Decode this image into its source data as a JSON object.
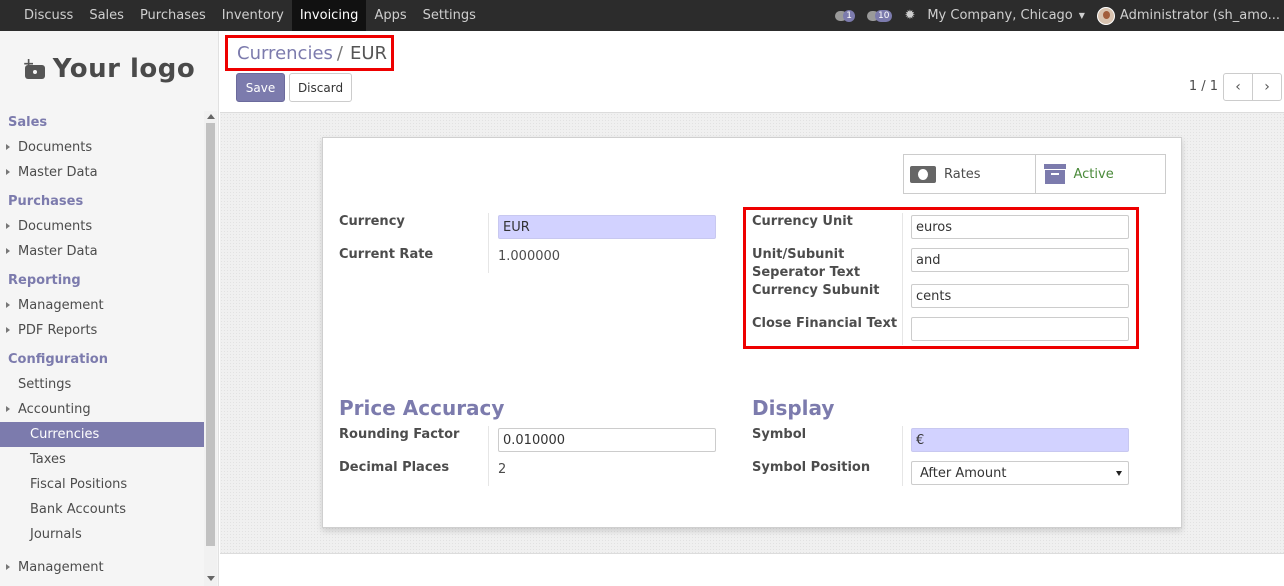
{
  "topbar": {
    "menu": [
      "Discuss",
      "Sales",
      "Purchases",
      "Inventory",
      "Invoicing",
      "Apps",
      "Settings"
    ],
    "active_menu": "Invoicing",
    "messages_count": "1",
    "activities_count": "10",
    "company": "My Company, Chicago",
    "user": "Administrator (sh_amo..."
  },
  "sidebar": {
    "logo_text": "Your logo",
    "sections": [
      {
        "title": "Sales",
        "items": [
          "Documents",
          "Master Data"
        ]
      },
      {
        "title": "Purchases",
        "items": [
          "Documents",
          "Master Data"
        ]
      },
      {
        "title": "Reporting",
        "items": [
          "Management",
          "PDF Reports"
        ]
      },
      {
        "title": "Configuration",
        "items": [
          "Settings",
          "Accounting",
          "Currencies",
          "Taxes",
          "Fiscal Positions",
          "Bank Accounts",
          "Journals",
          "Management"
        ]
      }
    ]
  },
  "control": {
    "breadcrumb_parent": "Currencies",
    "breadcrumb_sep": "/",
    "breadcrumb_current": "EUR",
    "save_label": "Save",
    "discard_label": "Discard",
    "pager": "1 / 1"
  },
  "form": {
    "smart_rates": "Rates",
    "smart_active": "Active",
    "currency_label": "Currency",
    "currency_value": "EUR",
    "current_rate_label": "Current Rate",
    "current_rate_value": "1.000000",
    "currency_unit_label": "Currency Unit",
    "currency_unit_value": "euros",
    "separator_label": "Unit/Subunit Seperator Text",
    "separator_value": "and",
    "currency_subunit_label": "Currency Subunit",
    "currency_subunit_value": "cents",
    "close_text_label": "Close Financial Text",
    "close_text_value": "",
    "price_accuracy_title": "Price Accuracy",
    "rounding_label": "Rounding Factor",
    "rounding_value": "0.010000",
    "decimal_label": "Decimal Places",
    "decimal_value": "2",
    "display_title": "Display",
    "symbol_label": "Symbol",
    "symbol_value": "€",
    "symbol_position_label": "Symbol Position",
    "symbol_position_value": "After Amount"
  },
  "colors": {
    "accent": "#7c7bad",
    "highlight_border": "#ee0000",
    "required_field": "#d2d2ff"
  }
}
